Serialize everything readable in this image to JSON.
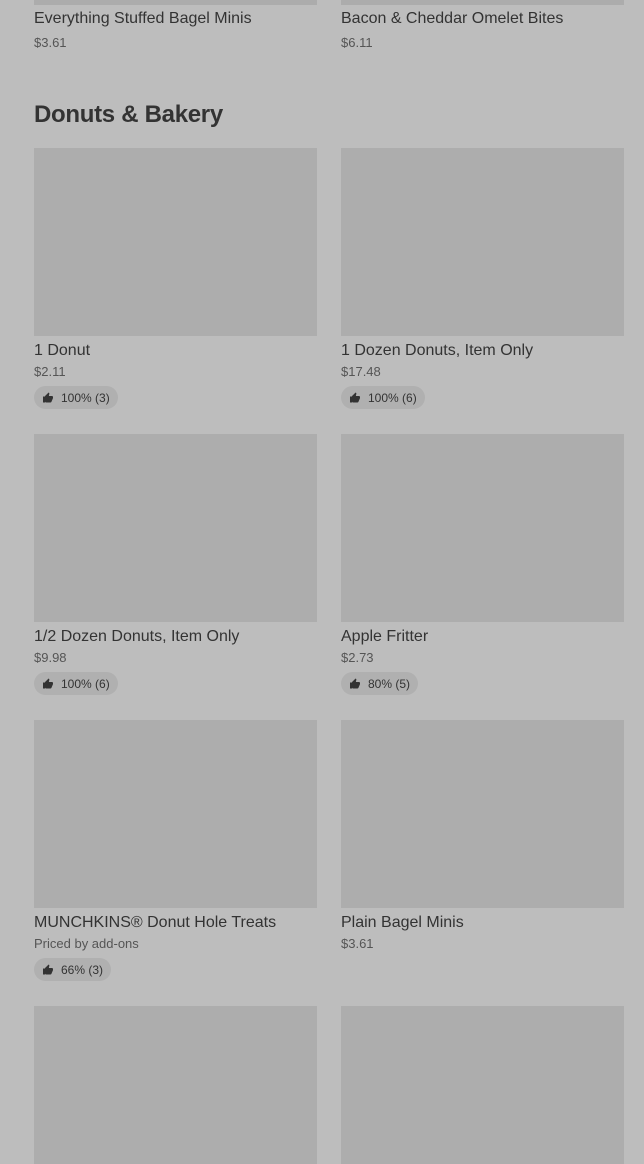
{
  "top_row": [
    {
      "name": "Everything Stuffed Bagel Minis",
      "price": "$3.61"
    },
    {
      "name": "Bacon & Cheddar Omelet Bites",
      "price": "$6.11"
    }
  ],
  "section": {
    "title": "Donuts & Bakery",
    "items": [
      {
        "name": "1 Donut",
        "price": "$2.11",
        "rating": "100% (3)"
      },
      {
        "name": "1 Dozen Donuts, Item Only",
        "price": "$17.48",
        "rating": "100% (6)"
      },
      {
        "name": "1/2 Dozen Donuts, Item Only",
        "price": "$9.98",
        "rating": "100% (6)"
      },
      {
        "name": "Apple Fritter",
        "price": "$2.73",
        "rating": "80% (5)"
      },
      {
        "name": "MUNCHKINS® Donut Hole Treats",
        "price": "Priced by add-ons",
        "rating": "66% (3)"
      },
      {
        "name": "Plain Bagel Minis",
        "price": "$3.61",
        "rating": null
      }
    ]
  },
  "icons": {
    "rating": "thumbs-up-icon"
  }
}
